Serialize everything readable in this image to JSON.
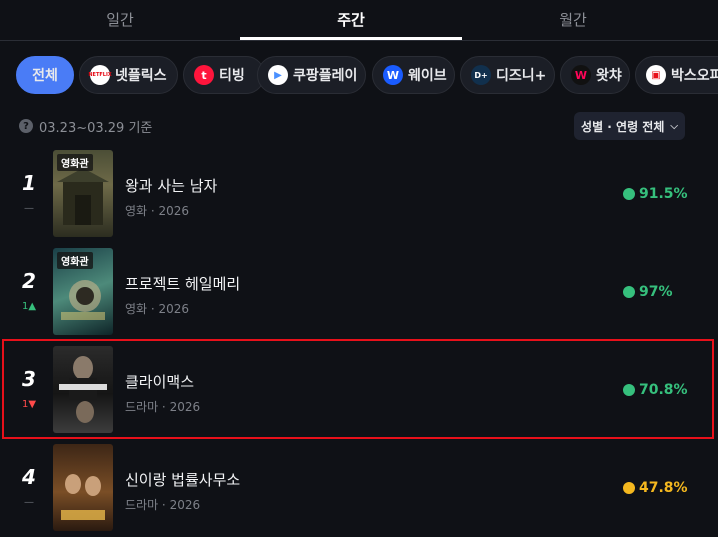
{
  "tabs": [
    {
      "label": "일간",
      "active": false
    },
    {
      "label": "주간",
      "active": true
    },
    {
      "label": "월간",
      "active": false
    }
  ],
  "platforms": [
    {
      "label": "전체",
      "icon": "",
      "active": true
    },
    {
      "label": "넷플릭스",
      "icon": "netflix-icon",
      "icon_text": "NETFLIX",
      "color": "#e50914",
      "bg": "#ffffff"
    },
    {
      "label": "티빙",
      "icon": "tving-icon",
      "icon_text": "t",
      "color": "#ffffff",
      "bg": "#ff153c"
    },
    {
      "label": "쿠팡플레이",
      "icon": "coupangplay-icon",
      "icon_text": "▶",
      "color": "#4a90ff",
      "bg": "#ffffff"
    },
    {
      "label": "웨이브",
      "icon": "wavve-icon",
      "icon_text": "W",
      "color": "#ffffff",
      "bg": "#1a5cff"
    },
    {
      "label": "디즈니+",
      "icon": "disneyplus-icon",
      "icon_text": "D+",
      "color": "#ffffff",
      "bg": "#11304d"
    },
    {
      "label": "왓챠",
      "icon": "watcha-icon",
      "icon_text": "W",
      "color": "#ff0558",
      "bg": "#111111"
    },
    {
      "label": "박스오피스",
      "icon": "boxoffice-icon",
      "icon_text": "🍿",
      "color": "#e8101a",
      "bg": "#ffffff"
    }
  ],
  "period": {
    "label": "03.23~03.29 기준",
    "icon": "question-icon"
  },
  "filter": {
    "label": "성별 · 연령 전체",
    "icon": "chevron-down-icon"
  },
  "rankings": [
    {
      "rank": "1",
      "delta": "—",
      "delta_type": "none",
      "badge": "영화관",
      "title": "왕과 사는 남자",
      "meta": "영화 · 2026",
      "score": "91.5%",
      "score_color": "green",
      "poster_colors": [
        "#3a3d2a",
        "#6b6b4a",
        "#22241a"
      ]
    },
    {
      "rank": "2",
      "delta": "1▲",
      "delta_type": "up",
      "badge": "영화관",
      "title": "프로젝트 헤일메리",
      "meta": "영화 · 2026",
      "score": "97%",
      "score_color": "green",
      "poster_colors": [
        "#1f4a52",
        "#3b7a6e",
        "#0d2226"
      ]
    },
    {
      "rank": "3",
      "delta": "1▼",
      "delta_type": "down",
      "badge": "",
      "title": "클라이맥스",
      "meta": "드라마 · 2026",
      "score": "70.8%",
      "score_color": "green",
      "poster_colors": [
        "#3a3a3a",
        "#1c1c1c",
        "#6a6a6a"
      ]
    },
    {
      "rank": "4",
      "delta": "—",
      "delta_type": "none",
      "badge": "",
      "title": "신이랑 법률사무소",
      "meta": "드라마 · 2026",
      "score": "47.8%",
      "score_color": "yellow",
      "poster_colors": [
        "#4a2e1a",
        "#8a5a2a",
        "#2a1a10"
      ]
    }
  ]
}
